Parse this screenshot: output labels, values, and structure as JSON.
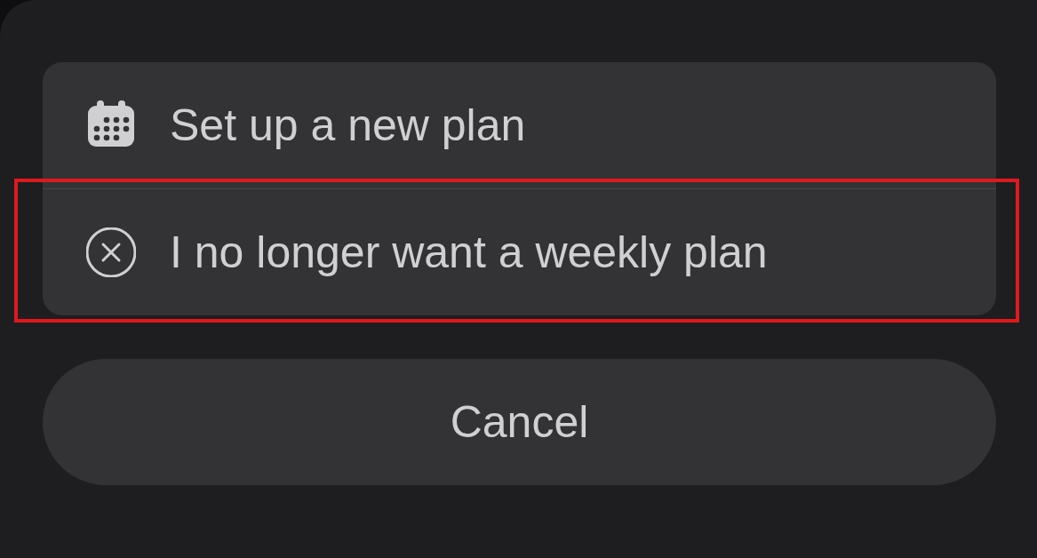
{
  "actions": [
    {
      "kind": "calendar",
      "label": "Set up a new plan",
      "highlighted": false
    },
    {
      "kind": "cancel-circle",
      "label": "I no longer want a weekly plan",
      "highlighted": true
    }
  ],
  "cancel_button": "Cancel"
}
